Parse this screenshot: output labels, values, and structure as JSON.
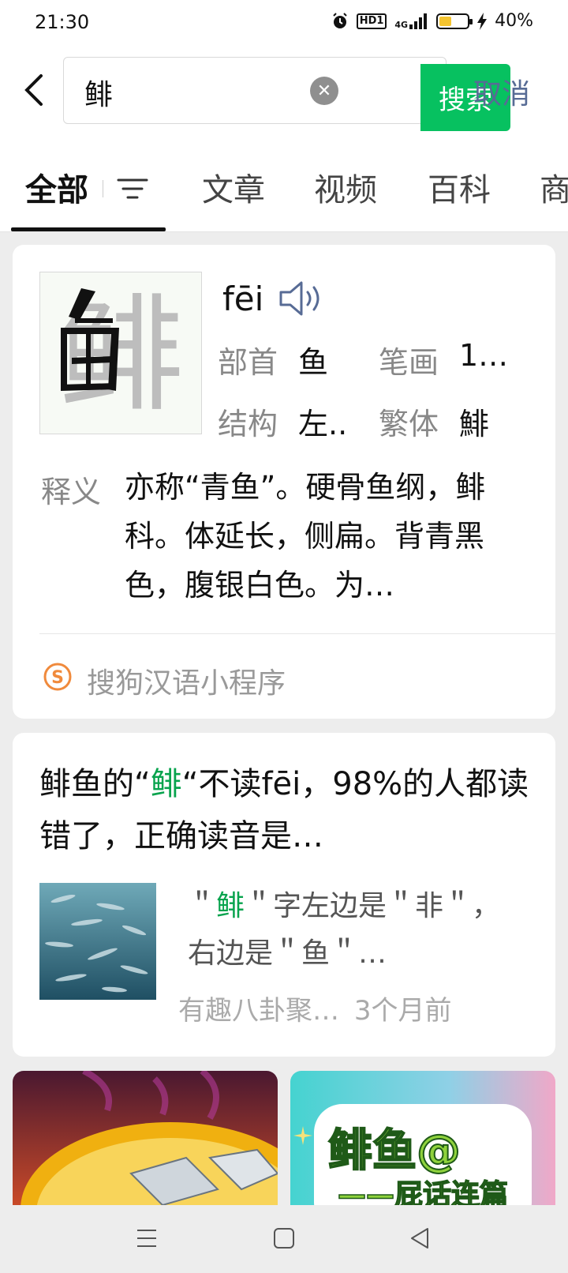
{
  "status_bar": {
    "time": "21:30",
    "hd": "HD1",
    "network": "4G",
    "battery_text": "40%",
    "battery_level": 0.4
  },
  "search": {
    "query": "鲱",
    "search_button": "搜索",
    "cancel_button": "取消"
  },
  "tabs": {
    "items": [
      "全部",
      "文章",
      "视频",
      "百科",
      "商"
    ],
    "active": "全部"
  },
  "dict_card": {
    "character": "鲱",
    "pinyin": "fēi",
    "radical_label": "部首",
    "radical_value": "鱼",
    "strokes_label": "笔画",
    "strokes_value": "1…",
    "structure_label": "结构",
    "structure_value": "左..",
    "traditional_label": "繁体",
    "traditional_value": "鯡",
    "definition_label": "释义",
    "definition_text": "亦称“青鱼”。硬骨鱼纲，鲱科。体延长，侧扁。背青黑色，腹银白色。为…",
    "source": "搜狗汉语小程序"
  },
  "article_card": {
    "title_part1": "鲱鱼的“",
    "title_highlight": "鲱",
    "title_part2": "“不读fēi，98%的人都读错了，正确读音是…",
    "snippet_part1": "＂",
    "snippet_highlight": "鲱",
    "snippet_part2": "＂字左边是＂非＂，右边是＂鱼＂…",
    "author": "有趣八卦聚…",
    "time": "3个月前"
  },
  "media_right": {
    "title": "鲱鱼@",
    "subtitle": "——屁话连篇"
  },
  "colors": {
    "accent_green": "#07c160",
    "link_blue": "#576b95",
    "highlight_green": "#07a34d"
  }
}
